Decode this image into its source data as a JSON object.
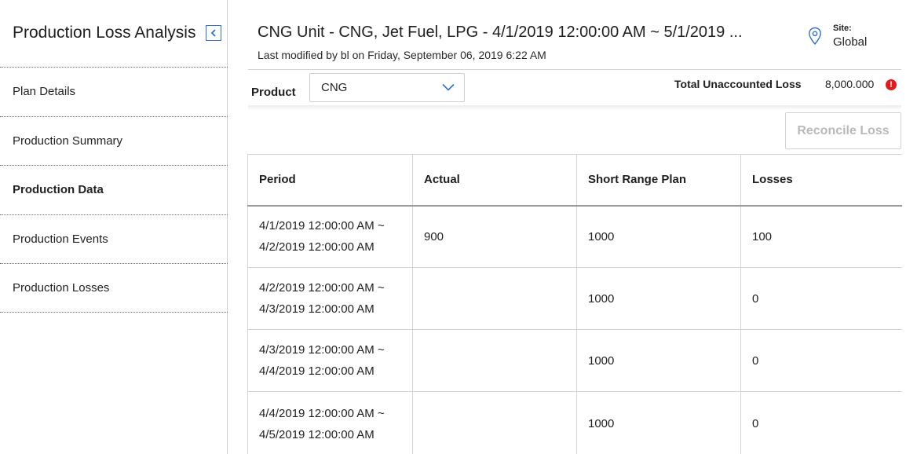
{
  "sidebar": {
    "title": "Production Loss Analysis",
    "items": [
      {
        "label": "Plan Details",
        "active": false
      },
      {
        "label": "Production Summary",
        "active": false
      },
      {
        "label": "Production Data",
        "active": true
      },
      {
        "label": "Production Events",
        "active": false
      },
      {
        "label": "Production Losses",
        "active": false
      }
    ]
  },
  "header": {
    "title": "CNG Unit - CNG, Jet Fuel, LPG - 4/1/2019 12:00:00 AM ~ 5/1/2019 ...",
    "subtitle": "Last modified by bl on Friday, September 06, 2019 6:22 AM",
    "site_label": "Site:",
    "site_value": "Global"
  },
  "filter": {
    "product_label": "Product",
    "product_value": "CNG",
    "loss_label": "Total Unaccounted Loss",
    "loss_value": "8,000.000",
    "alert_glyph": "!"
  },
  "toolbar": {
    "reconcile_label": "Reconcile Loss"
  },
  "table": {
    "headers": [
      "Period",
      "Actual",
      "Short Range Plan",
      "Losses"
    ],
    "rows": [
      {
        "period_start": "4/1/2019 12:00:00 AM ~",
        "period_end": "4/2/2019 12:00:00 AM",
        "actual": "900",
        "plan": "1000",
        "losses": "100"
      },
      {
        "period_start": "4/2/2019 12:00:00 AM ~",
        "period_end": "4/3/2019 12:00:00 AM",
        "actual": "",
        "plan": "1000",
        "losses": "0"
      },
      {
        "period_start": "4/3/2019 12:00:00 AM ~",
        "period_end": "4/4/2019 12:00:00 AM",
        "actual": "",
        "plan": "1000",
        "losses": "0"
      },
      {
        "period_start": "4/4/2019 12:00:00 AM ~",
        "period_end": "4/5/2019 12:00:00 AM",
        "actual": "",
        "plan": "1000",
        "losses": "0"
      }
    ]
  },
  "colors": {
    "accent": "#2f6fd1",
    "alert": "#e31b1b",
    "disabled_text": "#b9b9b9"
  },
  "icons": {
    "collapse": "chevron-left-icon",
    "site": "location-pin-icon",
    "dropdown": "chevron-down-icon",
    "alert": "alert-icon"
  }
}
